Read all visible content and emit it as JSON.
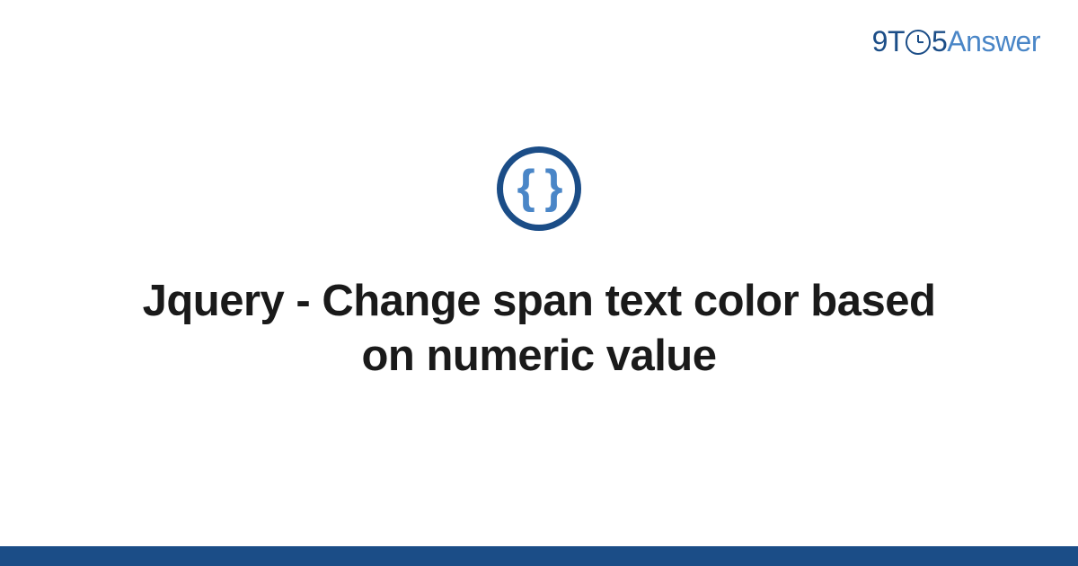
{
  "header": {
    "logo_part1": "9T",
    "logo_part2": "5",
    "logo_part3": "Answer"
  },
  "content": {
    "braces": "{ }",
    "title": "Jquery - Change span text color based on numeric value"
  }
}
